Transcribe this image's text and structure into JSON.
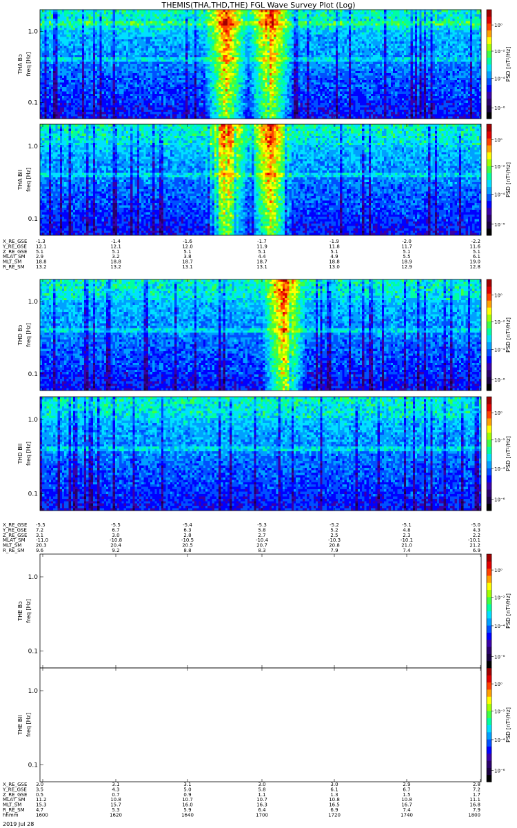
{
  "title": "THEMIS(THA,THD,THE) FGL Wave Survey Plot (Log)",
  "colors": {
    "colormap": [
      "#000000",
      "#1a0040",
      "#2a006b",
      "#3a00a8",
      "#0000ff",
      "#0050ff",
      "#00a0ff",
      "#00e0ff",
      "#00ffa0",
      "#40ff40",
      "#a0ff00",
      "#ffff00",
      "#ffa000",
      "#ff4000",
      "#e00000",
      "#a00000"
    ],
    "frame": "#000000",
    "background": "#ffffff"
  },
  "chart_data": [
    {
      "type": "heatmap",
      "id": "tha_bl",
      "ylabel": "THA Bↄ",
      "yunits": "freq [Hz]",
      "yticks": [
        "1.0",
        "0.1"
      ],
      "colorbar": {
        "label": "PSD [nT²/Hz]",
        "ticks": [
          "10⁰",
          "10⁻²",
          "10⁻⁴",
          "10⁻⁶"
        ]
      },
      "has_data": true,
      "features": {
        "burst_columns": [
          0.42,
          0.52
        ],
        "bright_bands": [
          0.12,
          0.45
        ]
      }
    },
    {
      "type": "heatmap",
      "id": "tha_bll",
      "ylabel": "THA Bll",
      "yunits": "freq [Hz]",
      "yticks": [
        "1.0",
        "0.1"
      ],
      "colorbar": {
        "label": "PSD [nT²/Hz]",
        "ticks": [
          "10⁰",
          "10⁻²",
          "10⁻⁴",
          "10⁻⁶"
        ]
      },
      "has_data": true,
      "features": {
        "burst_columns": [
          0.42,
          0.52
        ],
        "bright_bands": [
          0.45
        ]
      }
    },
    {
      "type": "heatmap",
      "id": "thd_bl",
      "ylabel": "THD Bↄ",
      "yunits": "freq [Hz]",
      "yticks": [
        "1.0",
        "0.1"
      ],
      "colorbar": {
        "label": "PSD [nT²/Hz]",
        "ticks": [
          "10⁰",
          "10⁻²",
          "10⁻⁴",
          "10⁻⁶"
        ]
      },
      "has_data": true,
      "features": {
        "burst_columns": [
          0.55
        ],
        "bright_bands": [
          0.45
        ]
      }
    },
    {
      "type": "heatmap",
      "id": "thd_bll",
      "ylabel": "THD Bll",
      "yunits": "freq [Hz]",
      "yticks": [
        "1.0",
        "0.1"
      ],
      "colorbar": {
        "label": "PSD [nT²/Hz]",
        "ticks": [
          "10⁰",
          "10⁻²",
          "10⁻⁴",
          "10⁻⁶"
        ]
      },
      "has_data": true,
      "features": {
        "burst_columns": [],
        "bright_bands": [
          0.45
        ]
      }
    },
    {
      "type": "heatmap",
      "id": "the_bl",
      "ylabel": "THE Bↄ",
      "yunits": "freq [Hz]",
      "yticks": [
        "1.0",
        "0.1"
      ],
      "colorbar": {
        "label": "PSD [nT²/Hz]",
        "ticks": [
          "10⁰",
          "10⁻²",
          "10⁻⁴",
          "10⁻⁶"
        ]
      },
      "has_data": false
    },
    {
      "type": "heatmap",
      "id": "the_bll",
      "ylabel": "THE Bll",
      "yunits": "freq [Hz]",
      "yticks": [
        "1.0",
        "0.1"
      ],
      "colorbar": {
        "label": "PSD [nT²/Hz]",
        "ticks": [
          "10⁰",
          "10⁻²",
          "10⁻⁴",
          "10⁻⁶"
        ]
      },
      "has_data": false
    }
  ],
  "ephemeris": [
    {
      "rows": [
        {
          "label": "X_RE_GSE",
          "values": [
            "-1.3",
            "-1.4",
            "-1.6",
            "-1.7",
            "-1.9",
            "-2.0",
            "-2.2"
          ]
        },
        {
          "label": "Y_RE_GSE",
          "values": [
            "12.1",
            "12.1",
            "12.0",
            "11.9",
            "11.8",
            "11.7",
            "11.6"
          ]
        },
        {
          "label": "Z_RE_GSE",
          "values": [
            "5.1",
            "5.1",
            "5.1",
            "5.1",
            "5.1",
            "5.1",
            "5.1"
          ]
        },
        {
          "label": "MLAT_SM",
          "values": [
            "2.9",
            "3.2",
            "3.8",
            "4.4",
            "4.9",
            "5.5",
            "6.1"
          ]
        },
        {
          "label": "MLT_SM",
          "values": [
            "18.8",
            "18.8",
            "18.7",
            "18.7",
            "18.8",
            "18.9",
            "19.0"
          ]
        },
        {
          "label": "R_RE_SM",
          "values": [
            "13.2",
            "13.2",
            "13.1",
            "13.1",
            "13.0",
            "12.9",
            "12.8"
          ]
        }
      ]
    },
    {
      "rows": [
        {
          "label": "X_RE_GSE",
          "values": [
            "-5.5",
            "-5.5",
            "-5.4",
            "-5.3",
            "-5.2",
            "-5.1",
            "-5.0"
          ]
        },
        {
          "label": "Y_RE_GSE",
          "values": [
            "7.2",
            "6.7",
            "6.3",
            "5.8",
            "5.2",
            "4.8",
            "4.3"
          ]
        },
        {
          "label": "Z_RE_GSE",
          "values": [
            "3.1",
            "3.0",
            "2.8",
            "2.7",
            "2.5",
            "2.3",
            "2.2"
          ]
        },
        {
          "label": "MLAT_SM",
          "values": [
            "-11.0",
            "-10.8",
            "-10.5",
            "-10.4",
            "-10.3",
            "-10.1",
            "-10.1"
          ]
        },
        {
          "label": "MLT_SM",
          "values": [
            "20.3",
            "20.4",
            "20.5",
            "20.7",
            "20.8",
            "21.0",
            "21.2"
          ]
        },
        {
          "label": "R_RE_SM",
          "values": [
            "9.6",
            "9.2",
            "8.8",
            "8.3",
            "7.9",
            "7.4",
            "6.9"
          ]
        }
      ]
    },
    {
      "rows": [
        {
          "label": "X_RE_GSE",
          "values": [
            "3.0",
            "3.1",
            "3.1",
            "3.0",
            "3.0",
            "2.9",
            "2.8"
          ]
        },
        {
          "label": "Y_RE_GSE",
          "values": [
            "3.5",
            "4.3",
            "5.0",
            "5.8",
            "6.1",
            "6.7",
            "7.2"
          ]
        },
        {
          "label": "Z_RE_GSE",
          "values": [
            "0.5",
            "0.7",
            "0.9",
            "1.1",
            "1.3",
            "1.5",
            "1.7"
          ]
        },
        {
          "label": "MLAT_SM",
          "values": [
            "11.2",
            "10.8",
            "10.7",
            "10.7",
            "10.8",
            "10.8",
            "11.1"
          ]
        },
        {
          "label": "MLT_SM",
          "values": [
            "15.3",
            "15.7",
            "16.0",
            "16.3",
            "16.5",
            "16.7",
            "16.8"
          ]
        },
        {
          "label": "R_RE_SM",
          "values": [
            "4.7",
            "5.3",
            "5.9",
            "6.4",
            "6.9",
            "7.4",
            "7.9"
          ]
        },
        {
          "label": "hhmm",
          "values": [
            "1600",
            "1620",
            "1640",
            "1700",
            "1720",
            "1740",
            "1800"
          ]
        }
      ]
    }
  ],
  "date_label": "2019 Jul 28"
}
